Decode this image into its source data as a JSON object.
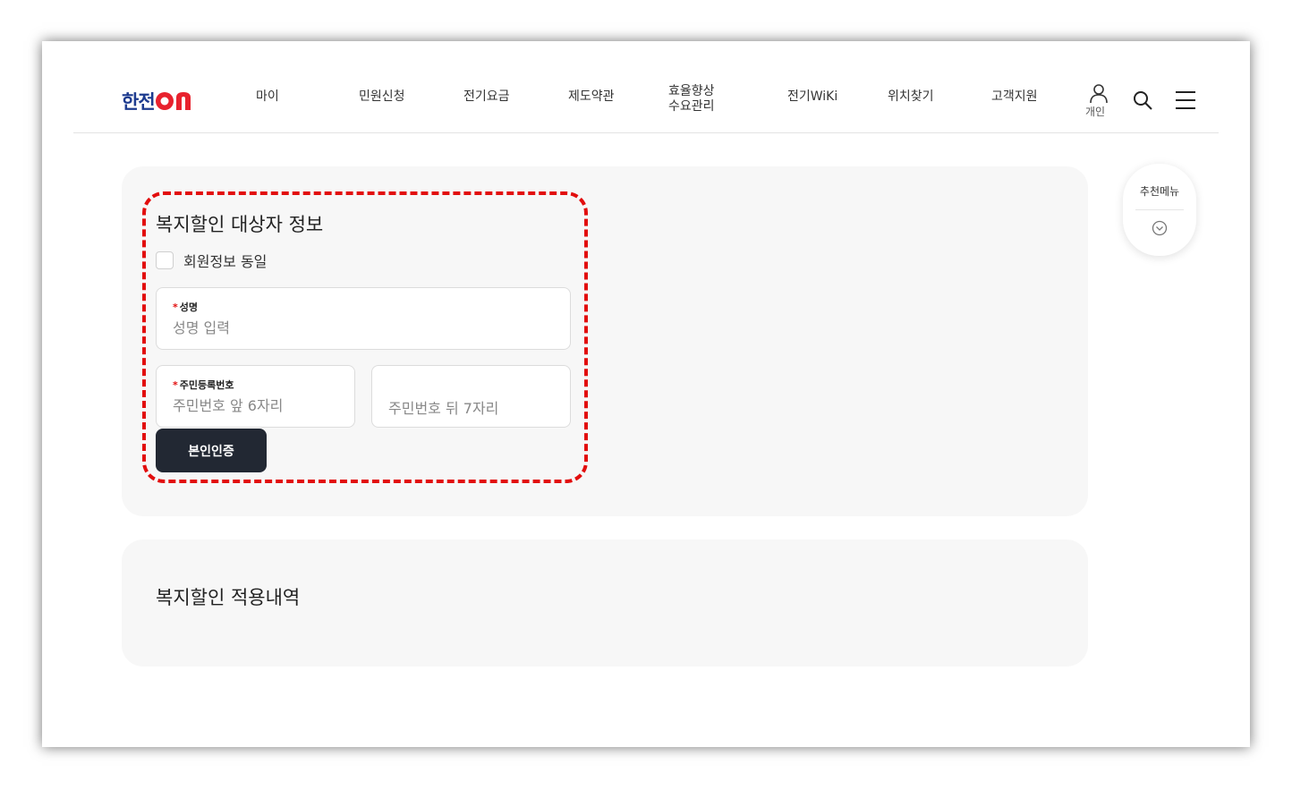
{
  "header": {
    "logo_text": "한전",
    "logo_on": "ON",
    "nav": [
      {
        "label": "마이"
      },
      {
        "label": "민원신청"
      },
      {
        "label": "전기요금"
      },
      {
        "label": "제도약관"
      },
      {
        "line1": "효율향상",
        "line2": "수요관리"
      },
      {
        "label": "전기WiKi"
      },
      {
        "label": "위치찾기"
      },
      {
        "label": "고객지원"
      }
    ],
    "user_label": "개인"
  },
  "recommend": {
    "label": "추천메뉴"
  },
  "welfare_form": {
    "title": "복지할인 대상자 정보",
    "same_as_member_label": "회원정보 동일",
    "name_field": {
      "label": "성명",
      "placeholder": "성명 입력",
      "value": ""
    },
    "rrn_field": {
      "label": "주민등록번호",
      "front_placeholder": "주민번호 앞 6자리",
      "back_placeholder": "주민번호 뒤 7자리"
    },
    "verify_button": "본인인증"
  },
  "history": {
    "title": "복지할인 적용내역"
  },
  "colors": {
    "brand_blue": "#1d3b8f",
    "brand_red": "#e8222e",
    "highlight": "#e20e0e",
    "button_dark": "#222833"
  }
}
